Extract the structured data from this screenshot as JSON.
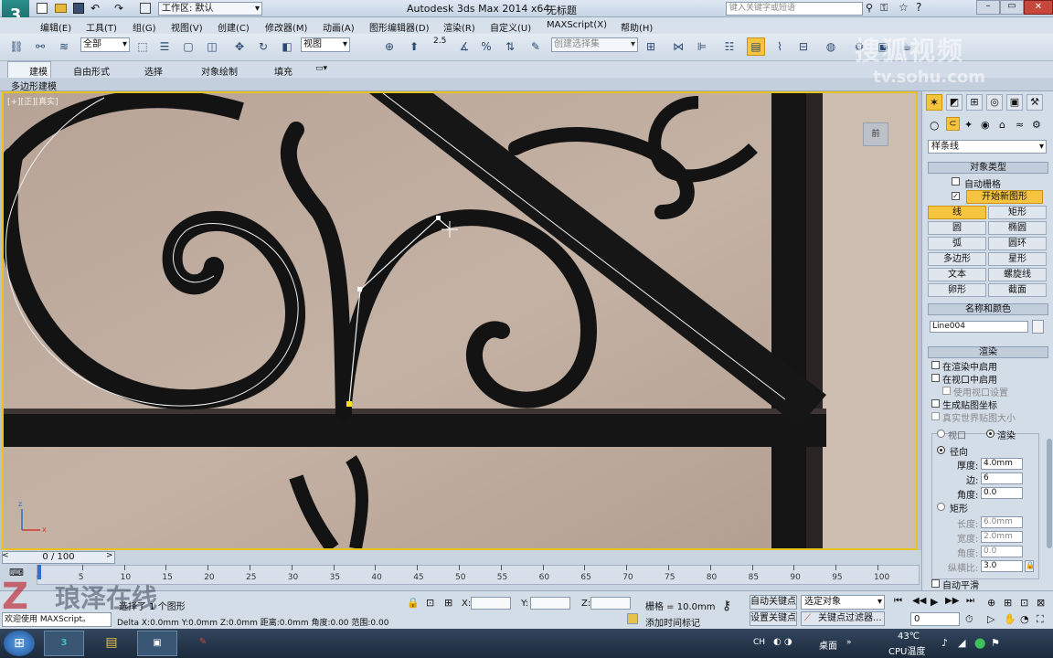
{
  "title_bar": {
    "workspace_label": "工作区: 默认",
    "app_title": "Autodesk 3ds Max  2014 x64",
    "doc_title": "无标题",
    "search_placeholder": "键入关键字或短语"
  },
  "menu": [
    "编辑(E)",
    "工具(T)",
    "组(G)",
    "视图(V)",
    "创建(C)",
    "修改器(M)",
    "动画(A)",
    "图形编辑器(D)",
    "渲染(R)",
    "自定义(U)",
    "MAXScript(X)",
    "帮助(H)"
  ],
  "toolbar": {
    "selection_filter": "全部",
    "ref_coord": "视图",
    "snap_value": "2.5",
    "named_selection_placeholder": "创建选择集"
  },
  "ribbon": {
    "tabs": [
      "建模",
      "自由形式",
      "选择",
      "对象绘制",
      "填充"
    ],
    "sub_label": "多边形建模"
  },
  "viewport": {
    "label": "[+][正][真实]",
    "watermark_line1": "搜狐视频",
    "watermark_line2": "tv.sohu.com"
  },
  "command_panel": {
    "category": "样条线",
    "object_type_header": "对象类型",
    "autogrid_label": "自动栅格",
    "start_new_shape": "开始新图形",
    "shape_buttons": [
      {
        "label": "线",
        "active": true
      },
      {
        "label": "矩形",
        "active": false
      },
      {
        "label": "圆",
        "active": false
      },
      {
        "label": "椭圆",
        "active": false
      },
      {
        "label": "弧",
        "active": false
      },
      {
        "label": "圆环",
        "active": false
      },
      {
        "label": "多边形",
        "active": false
      },
      {
        "label": "星形",
        "active": false
      },
      {
        "label": "文本",
        "active": false
      },
      {
        "label": "螺旋线",
        "active": false
      },
      {
        "label": "卵形",
        "active": false
      },
      {
        "label": "截面",
        "active": false
      }
    ],
    "name_color_header": "名称和颜色",
    "object_name": "Line004",
    "render_header": "渲染",
    "render_options": [
      "在渲染中启用",
      "在视口中启用",
      "使用视口设置",
      "生成贴图坐标",
      "真实世界贴图大小"
    ],
    "viewport_radio": "视口",
    "render_radio": "渲染",
    "radial_label": "径向",
    "thickness_label": "厚度:",
    "thickness_value": "4.0mm",
    "sides_label": "边:",
    "sides_value": "6",
    "angle_label": "角度:",
    "angle_value": "0.0",
    "rect_label": "矩形",
    "length_label": "长度:",
    "length_value": "6.0mm",
    "width_label": "宽度:",
    "width_value": "2.0mm",
    "rect_angle_label": "角度:",
    "rect_angle_value": "0.0",
    "aspect_label": "纵横比:",
    "aspect_value": "3.0",
    "auto_smooth": "自动平滑"
  },
  "timeline": {
    "frame_display": "0 / 100",
    "ticks": [
      "0",
      "5",
      "10",
      "15",
      "20",
      "25",
      "30",
      "35",
      "40",
      "45",
      "50",
      "55",
      "60",
      "65",
      "70",
      "75",
      "80",
      "85",
      "90",
      "95",
      "100"
    ]
  },
  "status": {
    "selected_text": "选择了 1 个图形",
    "x_label": "X:",
    "y_label": "Y:",
    "z_label": "Z:",
    "grid_text": "栅格 = 10.0mm",
    "auto_key": "自动关键点",
    "selected_object": "选定对象",
    "set_key": "设置关键点",
    "key_filters": "关键点过滤器...",
    "add_time_tag": "添加时间标记",
    "prompt": "欢迎使用 MAXScript。",
    "delta_text": "Delta X:0.0mm Y:0.0mm Z:0.0mm 距离:0.0mm 角度:0.00 范围:0.00",
    "current_frame": "0"
  },
  "logo_overlay": "琅泽在线",
  "taskbar": {
    "lang": "CH",
    "desktop": "桌面",
    "temp": "43℃",
    "cpu_label": "CPU温度"
  }
}
